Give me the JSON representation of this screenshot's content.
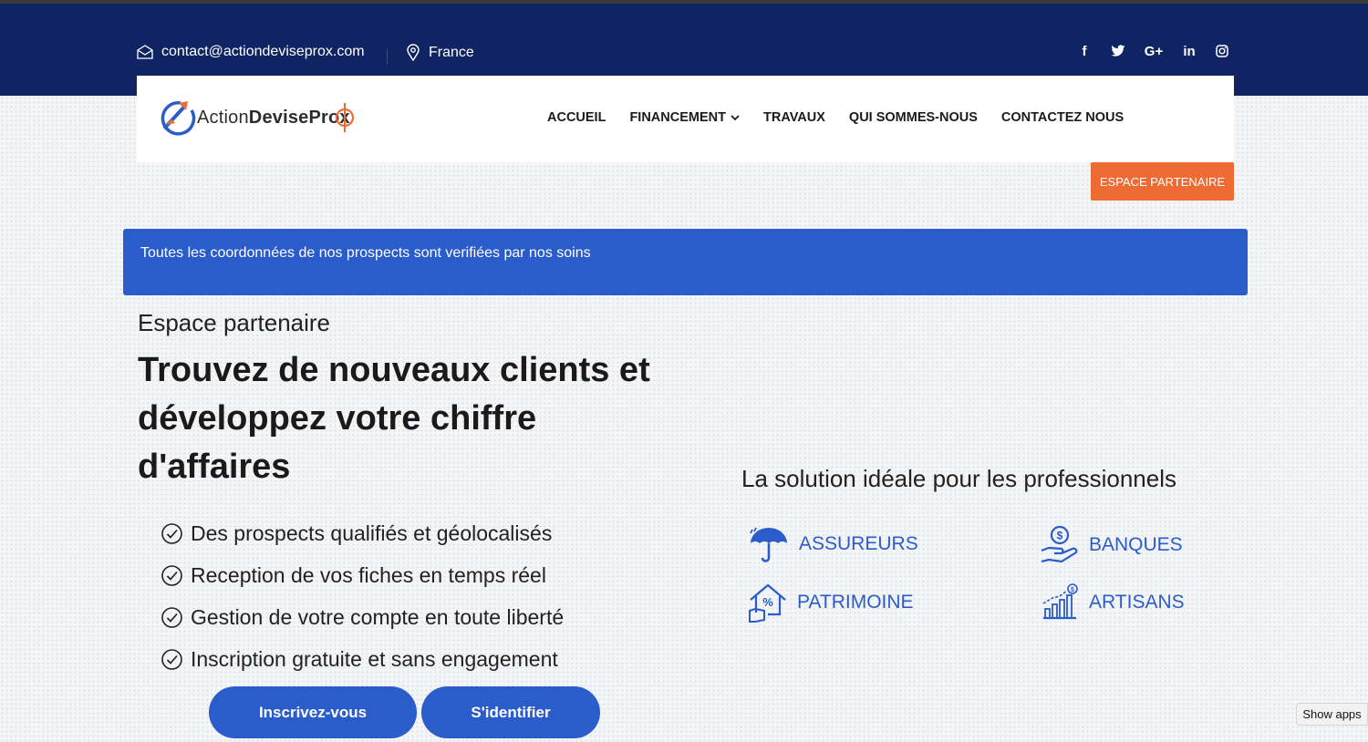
{
  "topbar": {
    "email": "contact@actiondeviseprox.com",
    "location": "France",
    "socials": [
      {
        "icon": "facebook-icon",
        "glyph": "f"
      },
      {
        "icon": "twitter-icon",
        "glyph": ""
      },
      {
        "icon": "google-plus-icon",
        "glyph": "G+"
      },
      {
        "icon": "linkedin-icon",
        "glyph": "in"
      },
      {
        "icon": "instagram-icon",
        "glyph": ""
      }
    ]
  },
  "brand": {
    "part1": "Action",
    "part2": "DeviseProx"
  },
  "nav": {
    "items": [
      "ACCUEIL",
      "FINANCEMENT",
      "TRAVAUX",
      "QUI SOMMES-NOUS",
      "CONTACTEZ NOUS"
    ],
    "partner_button": "ESPACE PARTENAIRE"
  },
  "banner": {
    "text": "Toutes les coordonnées de nos prospects sont verifiées par nos soins"
  },
  "hero": {
    "eyebrow": "Espace partenaire",
    "headline": "Trouvez de nouveaux clients et développez votre chiffre d'affaires",
    "features": [
      "Des prospects qualifiés et géolocalisés",
      "Reception de vos fiches en temps réel",
      "Gestion de votre compte en toute liberté",
      "Inscription gratuite et sans engagement"
    ],
    "register_button": "Inscrivez-vous",
    "login_button": "S'identifier"
  },
  "solution": {
    "title": "La solution idéale pour les professionnels",
    "items": [
      {
        "label": "ASSUREURS",
        "icon": "umbrella-icon"
      },
      {
        "label": "BANQUES",
        "icon": "money-hand-icon"
      },
      {
        "label": "PATRIMOINE",
        "icon": "house-percent-icon"
      },
      {
        "label": "ARTISANS",
        "icon": "growth-chart-icon"
      }
    ]
  },
  "browser": {
    "show_apps": "Show apps"
  },
  "colors": {
    "navy": "#102463",
    "accent_blue": "#2b5ccb",
    "orange": "#ef6b34"
  }
}
